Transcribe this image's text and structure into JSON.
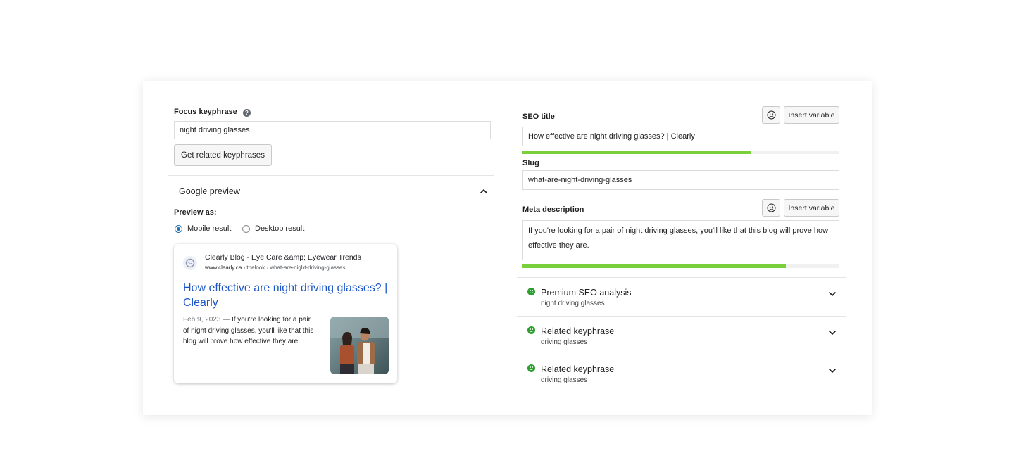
{
  "focus": {
    "label": "Focus keyphrase",
    "help_icon": "help-icon",
    "value": "night driving glasses",
    "related_button": "Get related keyphrases"
  },
  "google_preview": {
    "heading": "Google preview",
    "preview_as_label": "Preview as:",
    "mobile_label": "Mobile result",
    "desktop_label": "Desktop result",
    "selected": "mobile",
    "serp": {
      "site_name": "Clearly Blog - Eye Care &amp; Eyewear Trends",
      "breadcrumb_domain": "www.clearly.ca",
      "breadcrumb_path": " › thelook › what-are-night-driving-glasses",
      "title": "How effective are night driving glasses? | Clearly",
      "date": "Feb 9, 2023",
      "dash": " — ",
      "snippet": "If you're looking for a pair of night driving glasses, you'll like that this blog will prove how effective they are."
    }
  },
  "seo_title": {
    "label": "SEO title",
    "value": "How effective are night driving glasses? | Clearly",
    "insert_variable": "Insert variable",
    "progress_pct": 72
  },
  "slug": {
    "label": "Slug",
    "value": "what-are-night-driving-glasses"
  },
  "meta": {
    "label": "Meta description",
    "value": "If you're looking for a pair of night driving glasses, you'll like that this blog will prove how effective they are.",
    "insert_variable": "Insert variable",
    "progress_pct": 83
  },
  "accordions": [
    {
      "title": "Premium SEO analysis",
      "subtitle": "night driving glasses"
    },
    {
      "title": "Related keyphrase",
      "subtitle": "driving glasses"
    },
    {
      "title": "Related keyphrase",
      "subtitle": "driving glasses"
    }
  ],
  "colors": {
    "link_blue": "#1a0dab",
    "progress_green": "#7ad03a",
    "status_green": "#2e9e2e",
    "radio_blue": "#2271b1"
  }
}
